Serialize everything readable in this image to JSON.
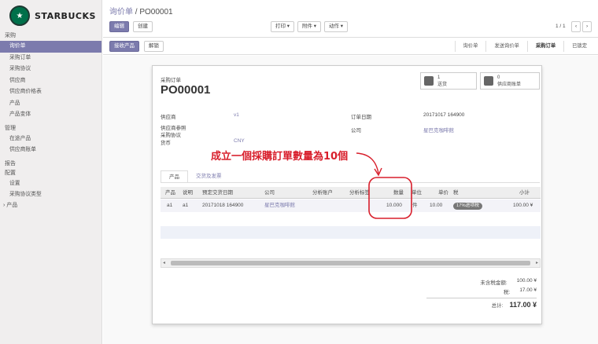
{
  "brand": "STARBUCKS",
  "sidebar": {
    "sections": [
      {
        "label": "采购",
        "items": [
          "询价单",
          "采购订单",
          "采购协议",
          "供应商",
          "供应商价格表",
          "产品",
          "产品变体"
        ]
      },
      {
        "label": "管理",
        "items": [
          "在途产品",
          "供应商账单"
        ]
      },
      {
        "label": "报告",
        "items": []
      },
      {
        "label": "配置",
        "items": [
          "设置",
          "采购协议类型"
        ]
      }
    ],
    "collapsed": "产品"
  },
  "breadcrumb": {
    "parent": "询价单",
    "sep": "/",
    "current": "PO00001"
  },
  "toolbar": {
    "edit": "编辑",
    "create": "创建",
    "print": "打印 ▾",
    "attach": "附件 ▾",
    "action": "动作 ▾",
    "pager": "1 / 1",
    "prev": "‹",
    "next": "›"
  },
  "status": {
    "receive": "接收产品",
    "unlock": "解锁",
    "steps": [
      "询价单",
      "发送询价单",
      "采购订单",
      "已锁定"
    ]
  },
  "form": {
    "doc_label": "采购订单",
    "doc_number": "PO00001",
    "stat_shipments": {
      "count": "1",
      "label": "送货"
    },
    "stat_bills": {
      "count": "0",
      "label": "供应商账单"
    },
    "vendor_label": "供应商",
    "vendor_value": "v1",
    "vendor_ref_label": "供应商参照",
    "agreement_label": "采购协议",
    "currency_label": "货币",
    "currency_value": "CNY",
    "order_date_label": "订单日期",
    "order_date_value": "20171017 164900",
    "company_label": "公司",
    "company_value": "星巴克咖啡館"
  },
  "tabs": [
    "产品",
    "交货及发票"
  ],
  "lines": {
    "columns": [
      "产品",
      "说明",
      "预定交货日期",
      "公司",
      "分析账户",
      "分析标签",
      "数量",
      "单位",
      "单价",
      "税",
      "小计"
    ],
    "rows": [
      {
        "product": "a1",
        "desc": "a1",
        "date": "20171018 164900",
        "company": "星巴克咖啡館",
        "qty": "10.000",
        "uom": "件",
        "price": "10.00",
        "tax": "17%进项税",
        "subtotal": "100.00 ¥"
      }
    ]
  },
  "totals": {
    "untaxed_label": "未含税金额:",
    "untaxed_value": "100.00 ¥",
    "tax_label": "税:",
    "tax_value": "17.00 ¥",
    "total_label": "总计:",
    "total_value": "117.00 ¥"
  },
  "annotation": {
    "text": "成立一個採購訂單數量為10個",
    "color": "#d81e2b"
  },
  "colors": {
    "accent": "#7c7bad",
    "brand": "#00704a"
  }
}
